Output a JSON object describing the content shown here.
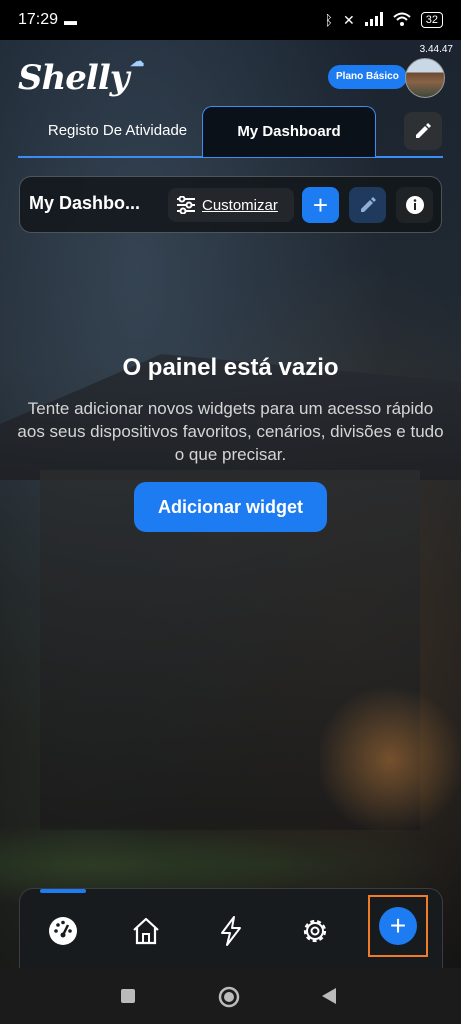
{
  "status_bar": {
    "time": "17:29",
    "battery": "32"
  },
  "app": {
    "version": "3.44.47",
    "logo_text": "Shelly",
    "plan_badge": "Plano Básico"
  },
  "tabs": [
    {
      "label": "Registo De Atividade",
      "active": false
    },
    {
      "label": "My Dashboard",
      "active": true
    }
  ],
  "dashboard_bar": {
    "title": "My Dashbo...",
    "customize_label": "Customizar"
  },
  "empty_state": {
    "title": "O painel está vazio",
    "description": "Tente adicionar novos widgets para um acesso rápido aos seus dispositivos favoritos, cenários, divisões e tudo o que precisar.",
    "add_button": "Adicionar widget"
  },
  "bottom_nav": {
    "items": [
      {
        "icon": "dashboard-gauge-icon",
        "active": true
      },
      {
        "icon": "home-icon",
        "active": false
      },
      {
        "icon": "bolt-icon",
        "active": false
      },
      {
        "icon": "gear-icon",
        "active": false
      },
      {
        "icon": "plus-icon",
        "active": false
      }
    ]
  },
  "colors": {
    "accent": "#1e7cf2",
    "highlight_border": "#f07c2a"
  }
}
